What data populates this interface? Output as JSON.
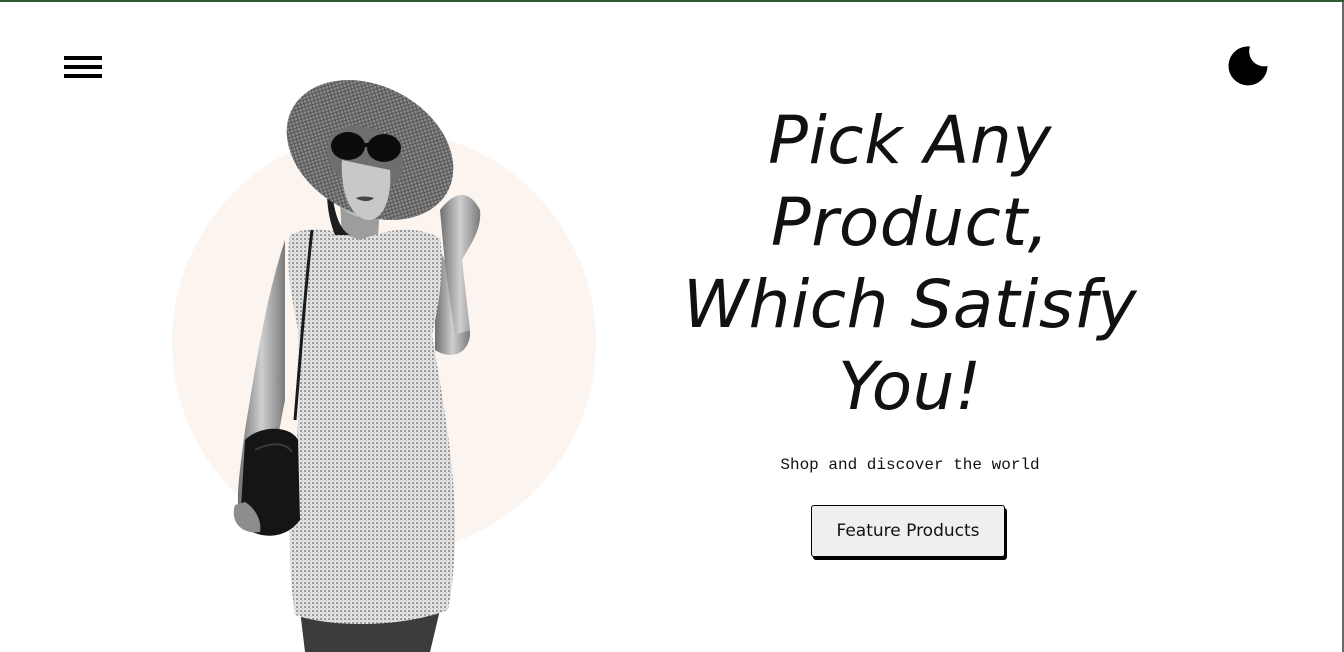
{
  "header": {
    "menu_icon": "hamburger-menu-icon",
    "theme_icon": "moon-icon"
  },
  "hero": {
    "headline_lines": [
      "Pick Any",
      "Product,",
      "Which Satisfy",
      "You!"
    ],
    "subtitle": "Shop and discover the world",
    "cta_label": "Feature Products",
    "image_subject": "woman in sun hat, sunglasses and dress holding handbag"
  },
  "colors": {
    "top_border": "#2e5d34",
    "circle_background": "#fcf5ef",
    "text": "#111111",
    "button_background": "#efefef"
  }
}
